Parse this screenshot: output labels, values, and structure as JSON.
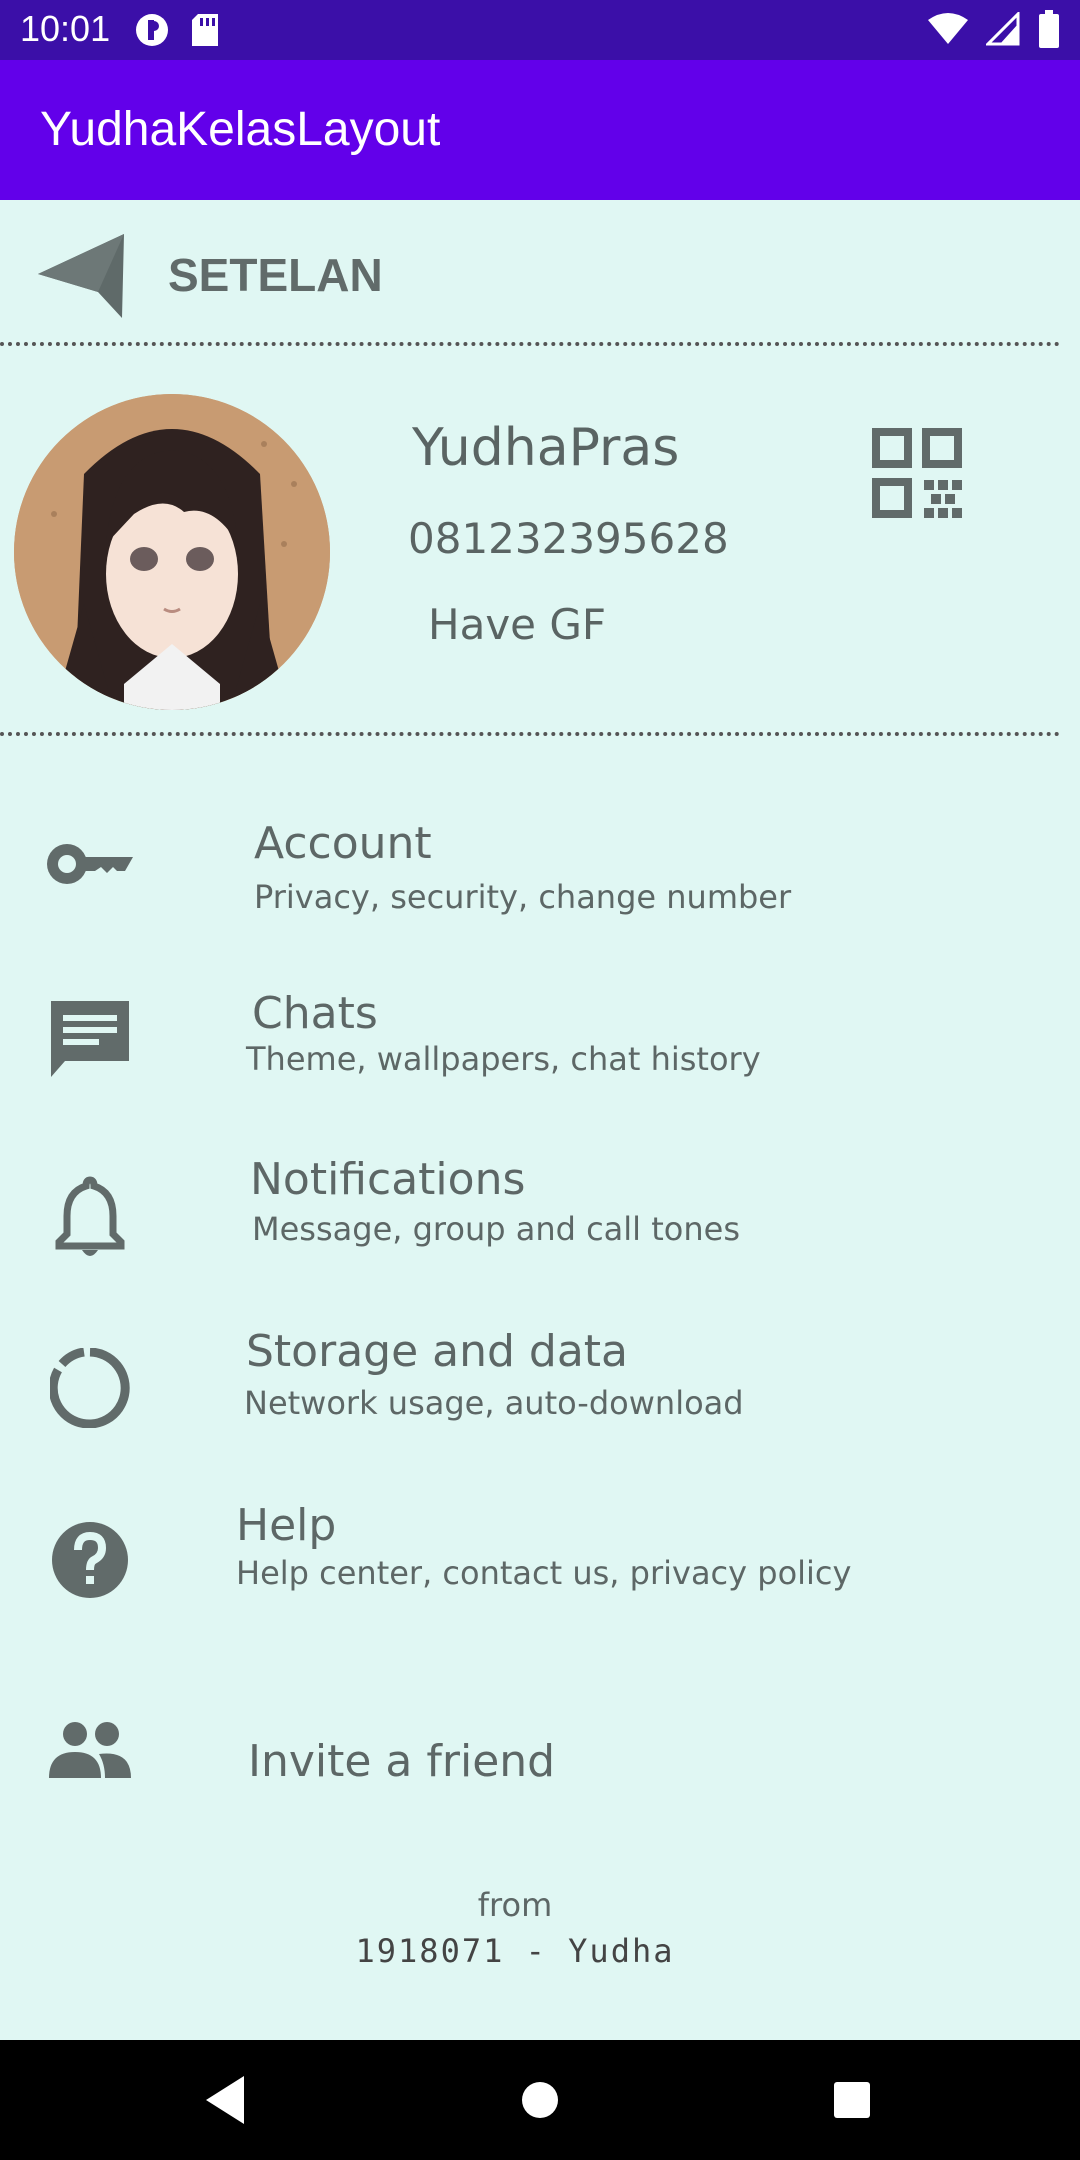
{
  "status_bar": {
    "time": "10:01"
  },
  "app_bar": {
    "title": "YudhaKelasLayout"
  },
  "header": {
    "title": "SETELAN"
  },
  "profile": {
    "name": "YudhaPras",
    "phone": "081232395628",
    "status": "Have GF"
  },
  "menu": {
    "items": [
      {
        "title": "Account",
        "subtitle": "Privacy, security, change number",
        "icon": "key-icon"
      },
      {
        "title": "Chats",
        "subtitle": "Theme, wallpapers, chat history",
        "icon": "chat-icon"
      },
      {
        "title": "Notifications",
        "subtitle": "Message, group and call tones",
        "icon": "bell-icon"
      },
      {
        "title": "Storage and data",
        "subtitle": "Network usage, auto-download",
        "icon": "storage-icon"
      },
      {
        "title": "Help",
        "subtitle": "Help center, contact us, privacy policy",
        "icon": "help-icon"
      },
      {
        "title": "Invite a friend",
        "subtitle": "",
        "icon": "people-icon"
      }
    ]
  },
  "footer": {
    "from": "from",
    "credit": "1918071  -  Yudha"
  },
  "colors": {
    "status_bar": "#3b0fa8",
    "app_bar": "#6200ea",
    "background": "#e0f7f3",
    "icon": "#616b6a"
  }
}
